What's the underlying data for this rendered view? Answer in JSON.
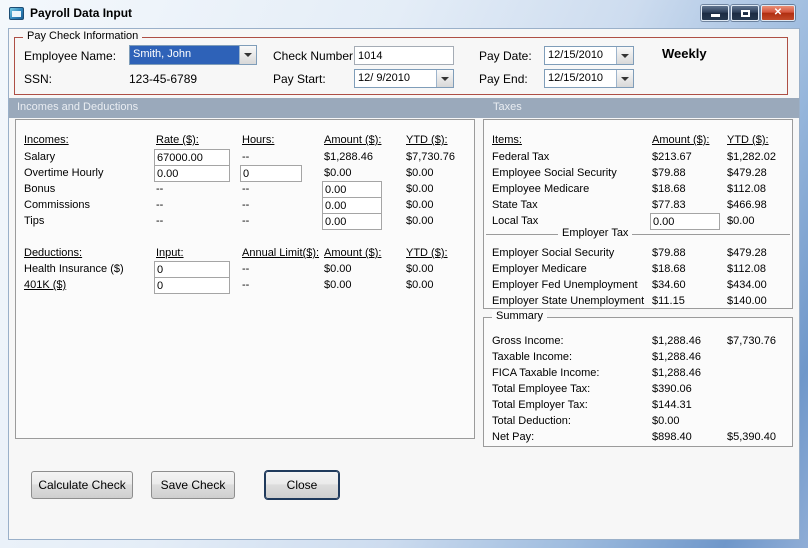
{
  "window": {
    "title": "Payroll Data Input",
    "controls": {
      "close_glyph": "✕"
    }
  },
  "colors": {
    "paycheck_border": "#AE4F45",
    "selection_blue": "#2E62B8",
    "section_band": "#9AA9BB",
    "close_button_red": "#C24A2A",
    "frame_blue": "#6F97CA"
  },
  "paycheck": {
    "legend": "Pay Check Information",
    "employee_name_label": "Employee Name:",
    "employee_name_value": "Smith, John",
    "ssn_label": "SSN:",
    "ssn_value": "123-45-6789",
    "check_number_label": "Check Number:",
    "check_number_value": "1014",
    "pay_start_label": "Pay Start:",
    "pay_start_value": "12/ 9/2010",
    "pay_date_label": "Pay Date:",
    "pay_date_value": "12/15/2010",
    "pay_end_label": "Pay End:",
    "pay_end_value": "12/15/2010",
    "frequency": "Weekly"
  },
  "sections": {
    "left": "Incomes and Deductions",
    "right": "Taxes"
  },
  "incomes": {
    "headers": {
      "item": "Incomes:",
      "rate": "Rate ($):",
      "hours": "Hours:",
      "amount": "Amount ($):",
      "ytd": "YTD ($):"
    },
    "rows": [
      {
        "label": "Salary",
        "rate": "67000.00",
        "hours": "--",
        "amount": "$1,288.46",
        "ytd": "$7,730.76"
      },
      {
        "label": "Overtime Hourly",
        "rate": "0.00",
        "hours": "0",
        "amount": "$0.00",
        "ytd": "$0.00"
      },
      {
        "label": "Bonus",
        "rate": "--",
        "hours": "--",
        "amount": "0.00",
        "ytd": "$0.00"
      },
      {
        "label": "Commissions",
        "rate": "--",
        "hours": "--",
        "amount": "0.00",
        "ytd": "$0.00"
      },
      {
        "label": "Tips",
        "rate": "--",
        "hours": "--",
        "amount": "0.00",
        "ytd": "$0.00"
      }
    ]
  },
  "deductions": {
    "headers": {
      "item": "Deductions:",
      "input": "Input:",
      "annual_limit": "Annual Limit($):",
      "amount": "Amount ($):",
      "ytd": "YTD ($):"
    },
    "rows": [
      {
        "label": "Health Insurance ($)",
        "input": "0",
        "annual_limit": "--",
        "amount": "$0.00",
        "ytd": "$0.00"
      },
      {
        "label": "401K ($)",
        "input": "0",
        "annual_limit": "--",
        "amount": "$0.00",
        "ytd": "$0.00"
      }
    ]
  },
  "taxes": {
    "headers": {
      "item": "Items:",
      "amount": "Amount ($):",
      "ytd": "YTD ($):"
    },
    "employee_rows": [
      {
        "label": "Federal Tax",
        "amount": "$213.67",
        "ytd": "$1,282.02"
      },
      {
        "label": "Employee Social Security",
        "amount": "$79.88",
        "ytd": "$479.28"
      },
      {
        "label": "Employee Medicare",
        "amount": "$18.68",
        "ytd": "$112.08"
      },
      {
        "label": "State Tax",
        "amount": "$77.83",
        "ytd": "$466.98"
      }
    ],
    "local_tax": {
      "label": "Local Tax",
      "amount": "0.00",
      "ytd": "$0.00"
    },
    "employer_section": "Employer Tax",
    "employer_rows": [
      {
        "label": "Employer Social Security",
        "amount": "$79.88",
        "ytd": "$479.28"
      },
      {
        "label": "Employer Medicare",
        "amount": "$18.68",
        "ytd": "$112.08"
      },
      {
        "label": "Employer Fed Unemployment",
        "amount": "$34.60",
        "ytd": "$434.00"
      },
      {
        "label": "Employer State Unemployment",
        "amount": "$11.15",
        "ytd": "$140.00"
      }
    ]
  },
  "summary": {
    "legend": "Summary",
    "rows": [
      {
        "label": "Gross Income:",
        "amount": "$1,288.46",
        "ytd": "$7,730.76"
      },
      {
        "label": "Taxable Income:",
        "amount": "$1,288.46",
        "ytd": ""
      },
      {
        "label": "FICA Taxable Income:",
        "amount": "$1,288.46",
        "ytd": ""
      },
      {
        "label": "Total Employee Tax:",
        "amount": "$390.06",
        "ytd": ""
      },
      {
        "label": "Total Employer Tax:",
        "amount": "$144.31",
        "ytd": ""
      },
      {
        "label": "Total Deduction:",
        "amount": "$0.00",
        "ytd": ""
      },
      {
        "label": "Net Pay:",
        "amount": "$898.40",
        "ytd": "$5,390.40"
      }
    ]
  },
  "buttons": {
    "calculate": "Calculate Check",
    "save": "Save Check",
    "close": "Close"
  }
}
